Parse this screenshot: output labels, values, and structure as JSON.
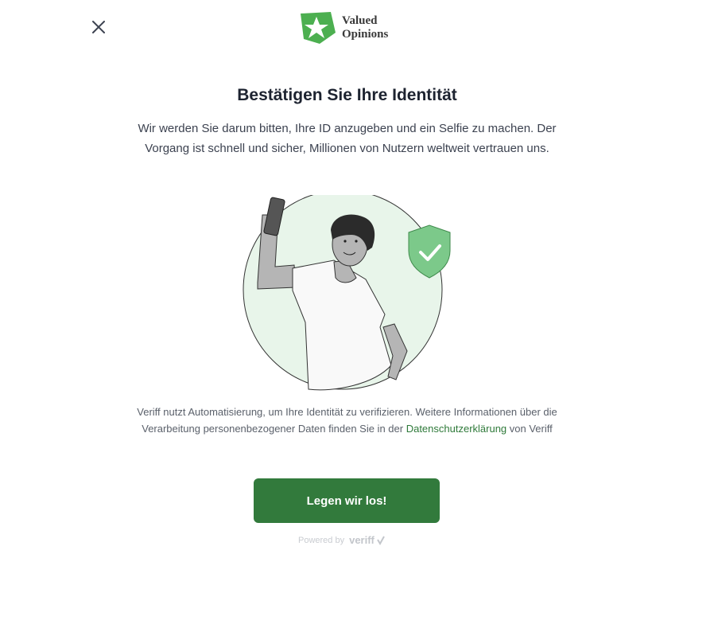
{
  "header": {
    "close_icon": "close-icon",
    "logo": {
      "line1": "Valued",
      "line2": "Opinions",
      "brand_color": "#4caf50"
    }
  },
  "main": {
    "title": "Bestätigen Sie Ihre Identität",
    "lead": "Wir werden Sie darum bitten, Ihre ID anzugeben und ein Selfie zu machen. Der Vorgang ist schnell und sicher, Millionen von Nutzern weltweit vertrauen uns.",
    "illustration": "person-taking-selfie-with-shield-check",
    "privacy": {
      "before": "Veriff nutzt Automatisierung, um Ihre Identität zu verifizieren. Weitere Informationen über die Verarbeitung personenbezogener Daten finden Sie in der ",
      "link": "Datenschutzerklärung",
      "after": " von Veriff"
    },
    "cta_label": "Legen wir los!"
  },
  "footer": {
    "powered_by": "Powered by",
    "brand": "veriff"
  },
  "colors": {
    "accent": "#327a3c",
    "link": "#2f7a3a",
    "shield": "#7cc98a",
    "circle_bg": "#e8f5ea"
  }
}
